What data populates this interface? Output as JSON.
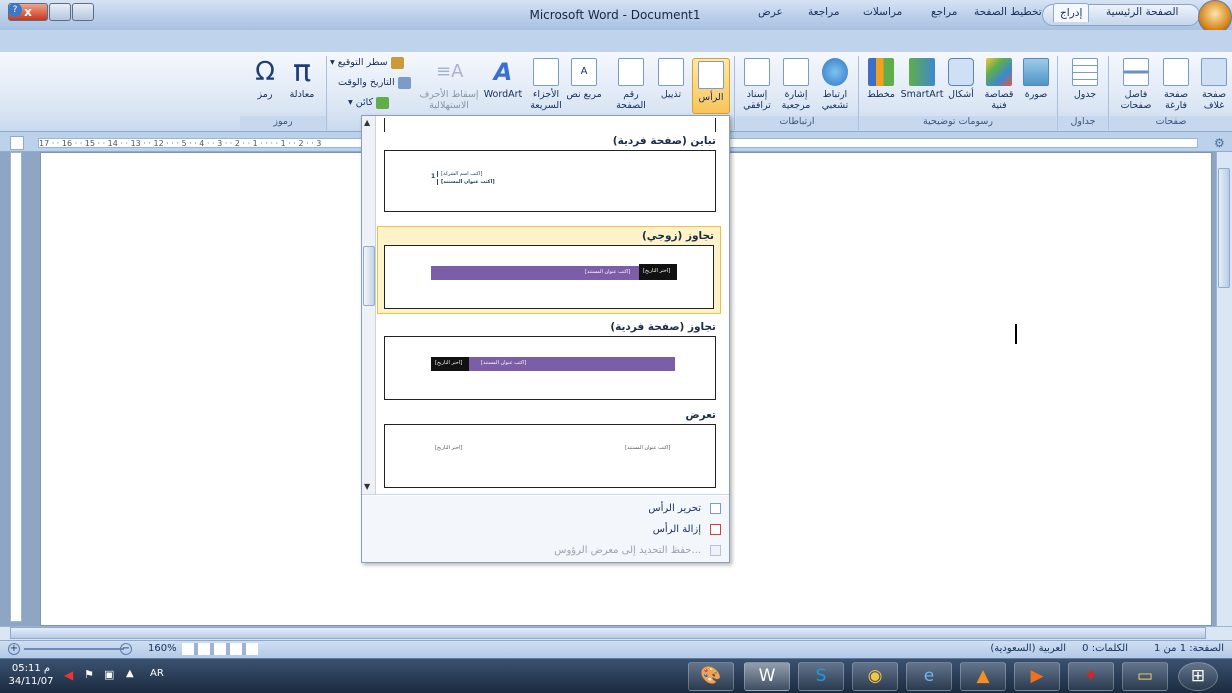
{
  "window": {
    "title": "Microsoft Word - Document1",
    "close": "x"
  },
  "tabs": [
    "الصفحة الرئيسية",
    "إدراج",
    "تخطيط الصفحة",
    "مراجع",
    "مراسلات",
    "مراجعة",
    "عرض"
  ],
  "ribbon": {
    "pages": {
      "label": "صفحات",
      "items": [
        "صفحة غلاف",
        "صفحة فارغة",
        "فاصل صفحات"
      ]
    },
    "tables": {
      "label": "جداول",
      "items": [
        "جدول"
      ]
    },
    "illustrations": {
      "label": "رسومات توضيحية",
      "items": [
        "صورة",
        "قصاصة فنية",
        "أشكال",
        "SmartArt",
        "مخطط"
      ]
    },
    "links": {
      "label": "ارتباطات",
      "items": [
        "ارتباط تشعبي",
        "إشارة مرجعية",
        "إسناد ترافقي"
      ]
    },
    "header_footer": {
      "items": [
        "الرأس",
        "تذييل",
        "رقم الصفحة"
      ]
    },
    "text": {
      "items": [
        "مربع نص",
        "الأجزاء السريعة",
        "WordArt",
        "إسقاط الأحرف الاستهلالية",
        "سطر التوقيع",
        "التاريخ والوقت",
        "كائن"
      ]
    },
    "symbols": {
      "label": "رموز",
      "items": [
        "معادلة",
        "رمز"
      ]
    }
  },
  "ruler": {
    "ticks": "17 · · 16 · · 15 · · 14 · · 13 · · 12 ·  · · 5 · · 4 · · 3 · · 2 · · 1 · · · · 1 · · 2 · · 3"
  },
  "gallery": {
    "items": [
      {
        "title": "تباين (صفحة فردية)",
        "lines": [
          "[اكتب اسم الشركة]",
          "[اكتب عنوان المستند]"
        ],
        "num": "1"
      },
      {
        "title": "تجاوز (زوجي)",
        "left": "[اكتب عنوان المستند]",
        "right": "[اختر التاريخ]"
      },
      {
        "title": "تجاوز (صفحة فردية)",
        "left": "[اختر التاريخ]",
        "right": "[اكتب عنوان المستند]"
      },
      {
        "title": "تعرض",
        "left": "[اختر التاريخ]",
        "right": "[اكتب عنوان المستند]"
      }
    ],
    "footer": [
      "تحرير الرأس",
      "إزالة الرأس",
      "حفظ التحديد إلى معرض الرؤوس..."
    ]
  },
  "status": {
    "page": "الصفحة: 1 من 1",
    "words": "الكلمات: 0",
    "lang": "العربية (السعودية)",
    "zoom": "160%"
  },
  "taskbar": {
    "time": "05:11 م",
    "date": "34/11/07",
    "lang": "AR"
  },
  "colors": {
    "ribbon": "#dbe6f4",
    "accent": "#7b5ea7",
    "gallery_sel": "#fdf2c8"
  }
}
